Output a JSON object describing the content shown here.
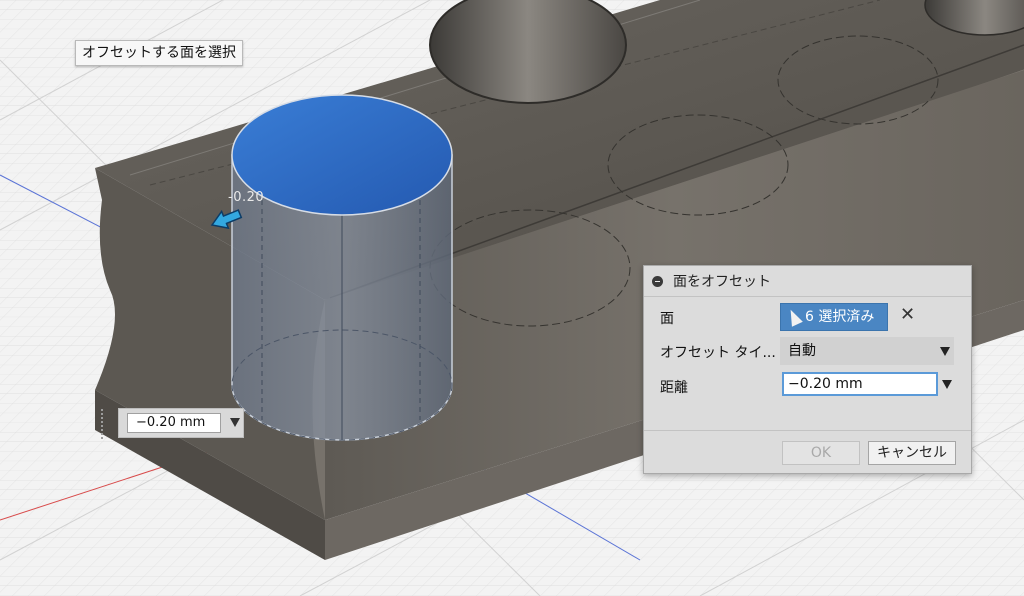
{
  "canvas": {
    "tooltip": "オフセットする面を選択",
    "dimension_label": "-0.20",
    "distance_value": "−0.20 mm"
  },
  "dialog": {
    "title": "面をオフセット",
    "face_label": "面",
    "face_selection": "6 選択済み",
    "offset_type_label": "オフセット タイ...",
    "offset_type_value": "自動",
    "distance_label": "距離",
    "distance_value": "−0.20 mm",
    "ok_label": "OK",
    "cancel_label": "キャンセル"
  },
  "colors": {
    "selected_face": "#2f6fcf",
    "accent": "#4a86c3"
  },
  "icons": [
    "collapse-icon",
    "cursor-icon",
    "close-icon",
    "chevron-down-icon",
    "arrow-left-icon"
  ]
}
